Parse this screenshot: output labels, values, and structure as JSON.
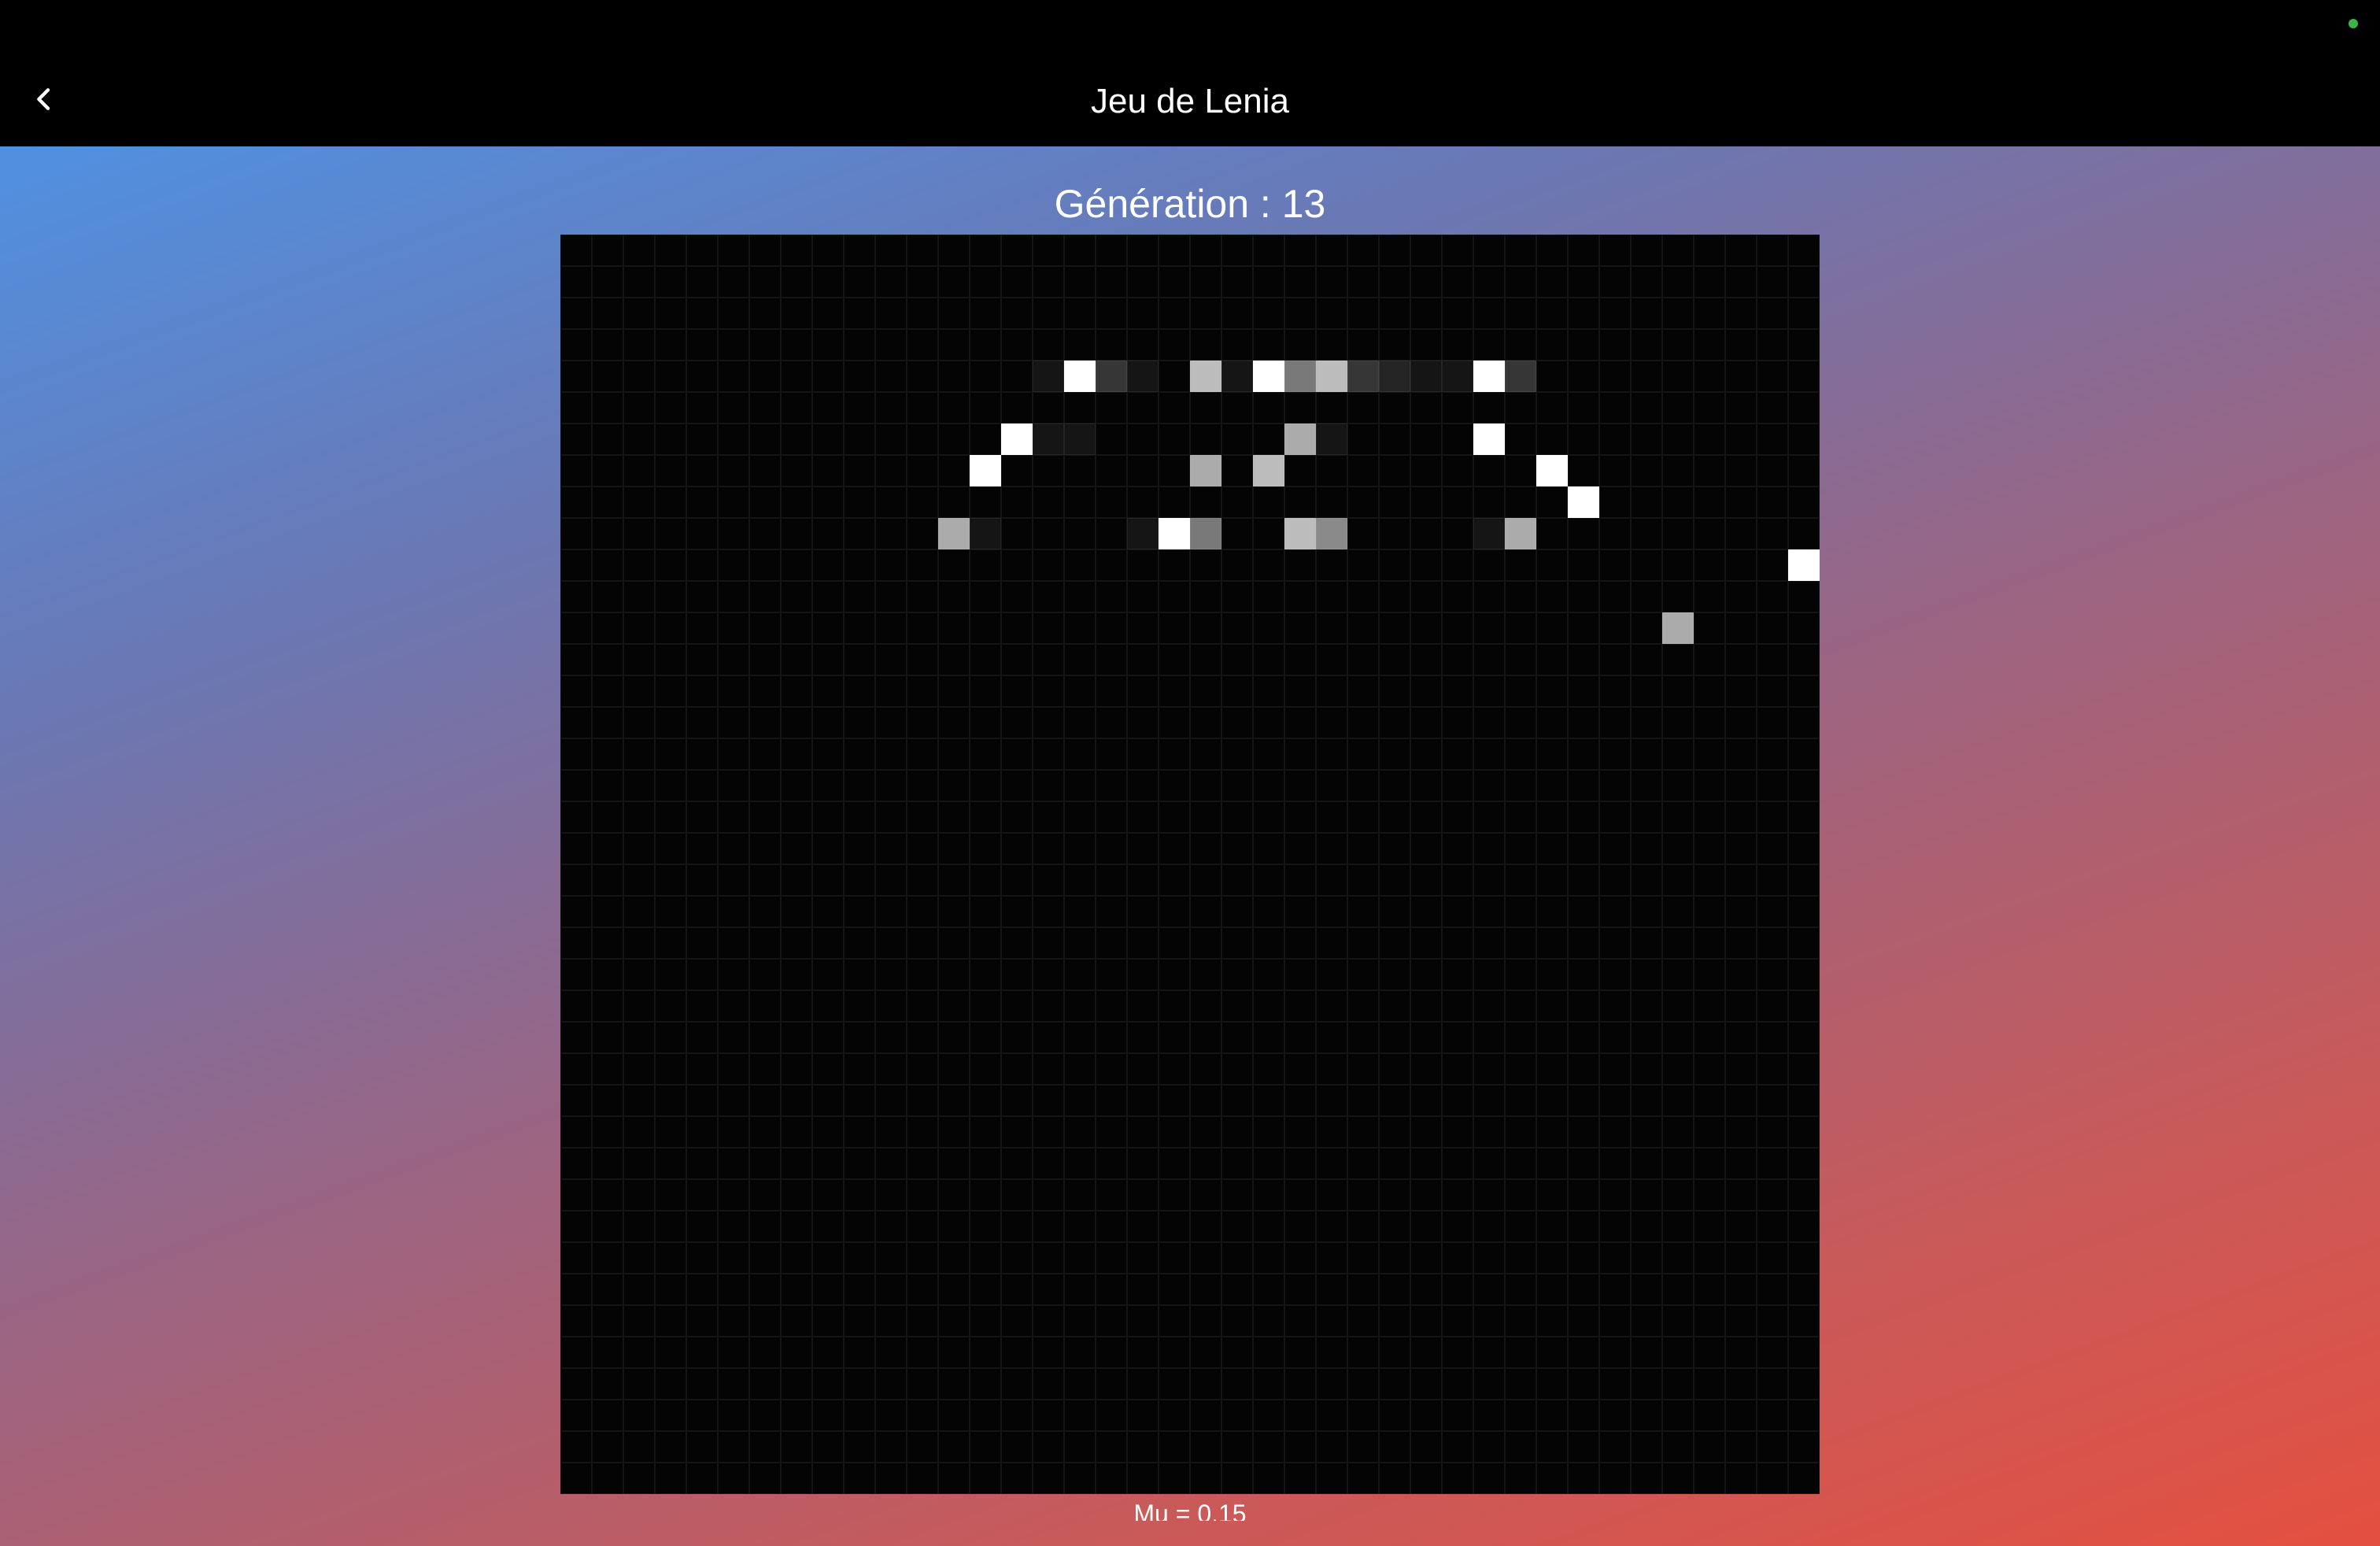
{
  "app_bar": {
    "title": "Jeu de Lenia",
    "back_icon": "chevron-left-icon"
  },
  "generation_label": "Génération : 13",
  "grid": {
    "rows": 40,
    "cols": 40,
    "cells": [
      "0000000000000000000000000000000000000000",
      "0000000000000000000000000000000000000000",
      "0000000000000000000000000000000000000000",
      "0000000000000000000000000000000000000000",
      "0000000000000001f310b1f7b3211f3000000000",
      "0000000000000000000000000000000000000000",
      "00000000000000f11000000a10000f0000000000",
      "0000000000000f000000a0b00000000f00000000",
      "00000000000000000000000000000000f0000000",
      "000000000000a100001f700b800001a000000000",
      "000000000000000000000000000000000000000f",
      "0000000000000000000000000000000000000000",
      "00000000000000000000000000000000000a0000",
      "0000000000000000000000000000000000000000",
      "0000000000000000000000000000000000000000",
      "0000000000000000000000000000000000000000",
      "0000000000000000000000000000000000000000",
      "0000000000000000000000000000000000000000",
      "0000000000000000000000000000000000000000",
      "0000000000000000000000000000000000000000",
      "0000000000000000000000000000000000000000",
      "0000000000000000000000000000000000000000",
      "0000000000000000000000000000000000000000",
      "0000000000000000000000000000000000000000",
      "0000000000000000000000000000000000000000",
      "0000000000000000000000000000000000000000",
      "0000000000000000000000000000000000000000",
      "0000000000000000000000000000000000000000",
      "0000000000000000000000000000000000000000",
      "0000000000000000000000000000000000000000",
      "0000000000000000000000000000000000000000",
      "0000000000000000000000000000000000000000",
      "0000000000000000000000000000000000000000",
      "0000000000000000000000000000000000000000",
      "0000000000000000000000000000000000000000",
      "0000000000000000000000000000000000000000",
      "0000000000000000000000000000000000000000",
      "0000000000000000000000000000000000000000",
      "0000000000000000000000000000000000000000",
      "0000000000000000000000000000000000000000"
    ]
  },
  "mu_label": "Mu = 0.15"
}
